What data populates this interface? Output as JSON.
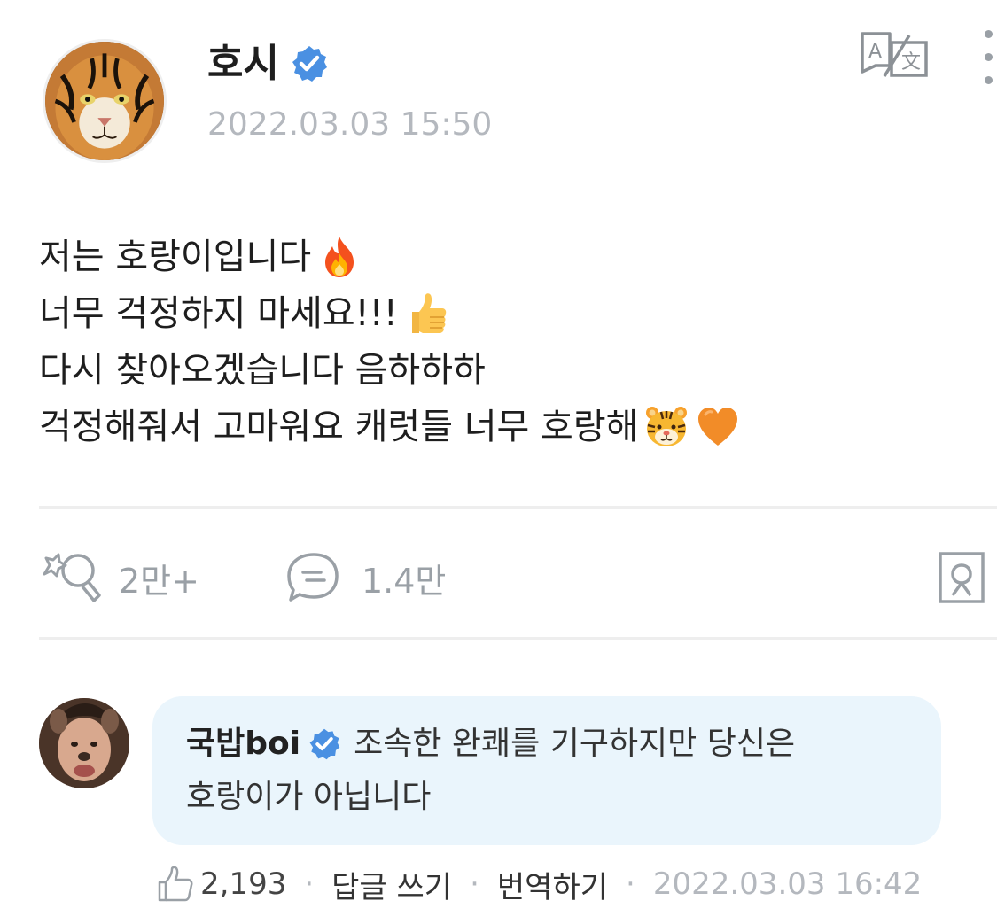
{
  "post": {
    "author": {
      "name": "호시",
      "verified": true,
      "avatar": "tiger-avatar"
    },
    "date": "2022.03.03 15:50",
    "body_lines": [
      {
        "text": "저는 호랑이입니다",
        "emoji": [
          "fire-emoji"
        ]
      },
      {
        "text": "너무 걱정하지 마세요!!!",
        "emoji": [
          "thumbs-up-emoji"
        ]
      },
      {
        "text": "다시 찾아오겠습니다 음하하하",
        "emoji": []
      },
      {
        "text": "걱정해줘서 고마워요 캐럿들 너무 호랑해",
        "emoji": [
          "tiger-face-emoji",
          "orange-heart-emoji"
        ]
      }
    ],
    "actions": {
      "reactions_count": "2만+",
      "comments_count": "1.4만"
    }
  },
  "comment": {
    "author": "국밥boi",
    "verified": true,
    "text": "조속한 완쾌를 기구하지만 당신은 호랑이가 아닙니다",
    "text_line1": "조속한 완쾌를 기구하지만 당신은",
    "text_line2": "호랑이가 아닙니다",
    "likes": "2,193",
    "reply_label": "답글 쓰기",
    "translate_label": "번역하기",
    "date": "2022.03.03 16:42"
  },
  "icons": {
    "verified_color": "#4a90e2",
    "action_icon_color": "#9aa0a6"
  }
}
